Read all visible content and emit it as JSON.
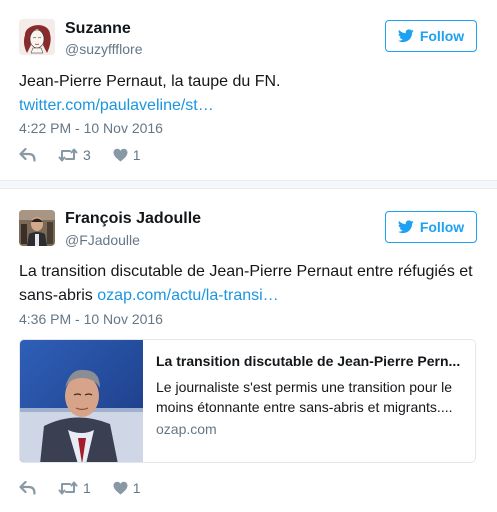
{
  "tweets": [
    {
      "name": "Suzanne",
      "handle": "@suzyffflore",
      "follow_label": "Follow",
      "text": "Jean-Pierre Pernaut, la taupe du FN.",
      "link": "twitter.com/paulaveline/st…",
      "time": "4:22 PM - 10 Nov 2016",
      "retweets": "3",
      "likes": "1"
    },
    {
      "name": "François Jadoulle",
      "handle": "@FJadoulle",
      "follow_label": "Follow",
      "text": "La transition discutable de Jean-Pierre Pernaut entre réfugiés et sans-abris",
      "link": "ozap.com/actu/la-transi…",
      "time": "4:36 PM - 10 Nov 2016",
      "card": {
        "title": "La transition discutable de Jean-Pierre Pern...",
        "description": "Le journaliste s'est permis une transition pour le moins étonnante entre sans-abris et migrants....",
        "domain": "ozap.com"
      },
      "retweets": "1",
      "likes": "1"
    }
  ],
  "colors": {
    "accent": "#1da1f2",
    "link": "#1b95e0",
    "muted": "#657786"
  },
  "icons": [
    "twitter-bird-icon",
    "reply-icon",
    "retweet-icon",
    "heart-icon"
  ]
}
